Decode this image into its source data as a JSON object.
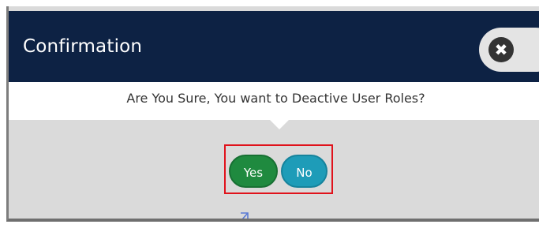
{
  "dialog": {
    "title": "Confirmation",
    "message": "Are You Sure, You want to Deactive User Roles?",
    "close_icon_glyph": "✖",
    "buttons": {
      "yes_label": "Yes",
      "no_label": "No"
    }
  },
  "colors": {
    "header_bg": "#0d2244",
    "yes_button": "#1f8a3f",
    "no_button": "#1e9cb8",
    "highlight_box": "#e0121b",
    "dialog_body": "#dadada"
  },
  "icons": {
    "close": "close-icon",
    "pointer": "mouse-pointer-icon"
  }
}
